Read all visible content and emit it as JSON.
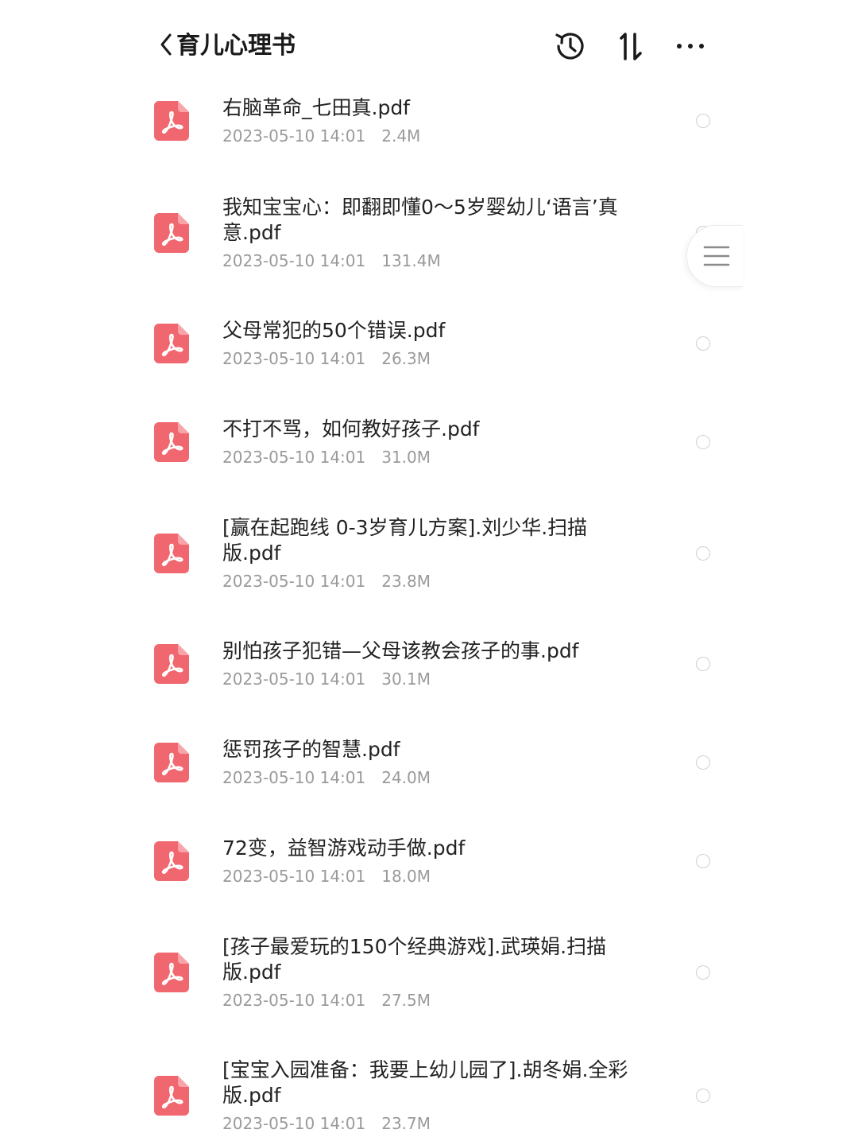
{
  "header": {
    "title": "育儿心理书",
    "back_icon": "chevron-left-icon",
    "actions": [
      "history-icon",
      "sort-icon",
      "more-icon"
    ]
  },
  "colors": {
    "pdf_icon": "#f0676f",
    "title": "#1a1a1a",
    "meta": "#9a9a9a"
  },
  "files": [
    {
      "name": "右脑革命_七田真.pdf",
      "date": "2023-05-10 14:01",
      "size": "2.4M"
    },
    {
      "name": "我知宝宝心：即翻即懂0～5岁婴幼儿‘语言’真意.pdf",
      "date": "2023-05-10 14:01",
      "size": "131.4M"
    },
    {
      "name": "父母常犯的50个错误.pdf",
      "date": "2023-05-10 14:01",
      "size": "26.3M"
    },
    {
      "name": "不打不骂，如何教好孩子.pdf",
      "date": "2023-05-10 14:01",
      "size": "31.0M"
    },
    {
      "name": "[赢在起跑线 0-3岁育儿方案].刘少华.扫描版.pdf",
      "date": "2023-05-10 14:01",
      "size": "23.8M"
    },
    {
      "name": "别怕孩子犯错—父母该教会孩子的事.pdf",
      "date": "2023-05-10 14:01",
      "size": "30.1M"
    },
    {
      "name": "惩罚孩子的智慧.pdf",
      "date": "2023-05-10 14:01",
      "size": "24.0M"
    },
    {
      "name": "72变，益智游戏动手做.pdf",
      "date": "2023-05-10 14:01",
      "size": "18.0M"
    },
    {
      "name": "[孩子最爱玩的150个经典游戏].武瑛娟.扫描版.pdf",
      "date": "2023-05-10 14:01",
      "size": "27.5M"
    },
    {
      "name": "[宝宝入园准备：我要上幼儿园了].胡冬娟.全彩版.pdf",
      "date": "2023-05-10 14:01",
      "size": "23.7M"
    }
  ],
  "floating_menu": {
    "icon": "menu-icon"
  }
}
